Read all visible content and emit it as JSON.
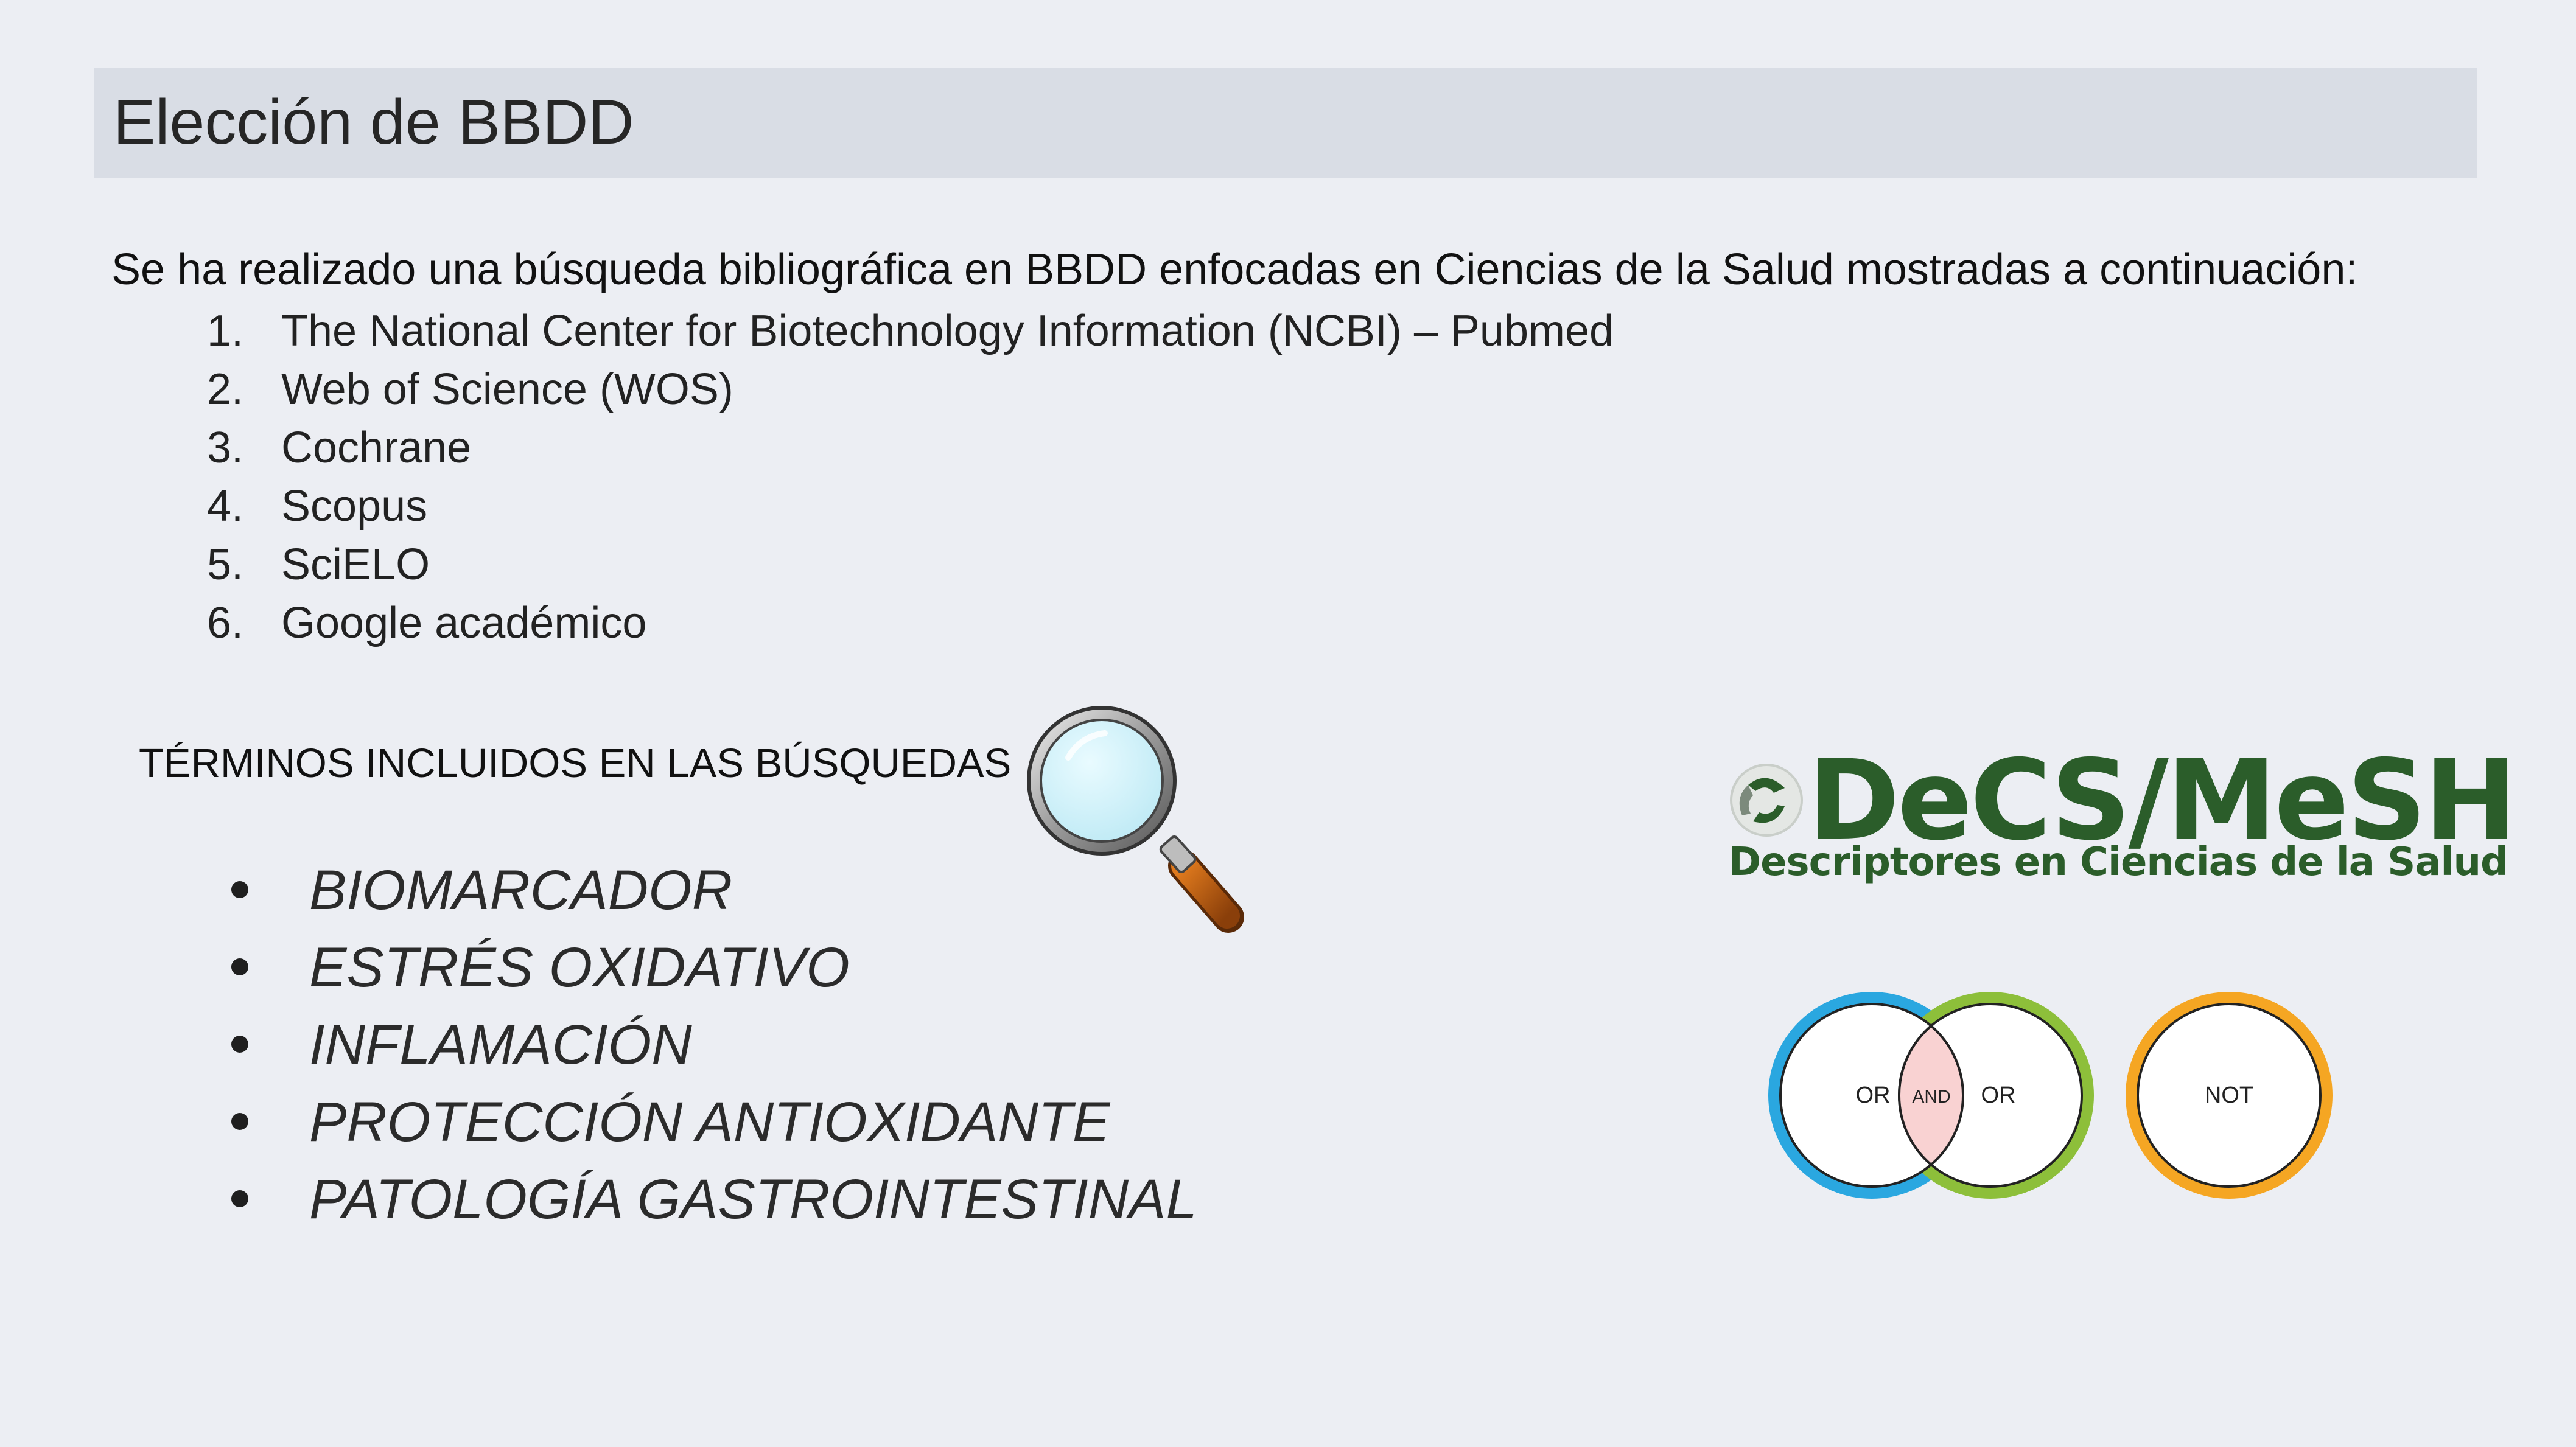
{
  "slide": {
    "title": "Elección de BBDD",
    "intro": "Se ha realizado una búsqueda bibliográfica en BBDD enfocadas en Ciencias de la Salud mostradas a continuación:"
  },
  "databases": [
    {
      "num": "1.",
      "label": "The National Center for Biotechnology Information (NCBI) – Pubmed"
    },
    {
      "num": "2.",
      "label": "Web of Science (WOS)"
    },
    {
      "num": "3.",
      "label": "Cochrane"
    },
    {
      "num": "4.",
      "label": "Scopus"
    },
    {
      "num": "5.",
      "label": "SciELO"
    },
    {
      "num": "6.",
      "label": "Google académico"
    }
  ],
  "terms": {
    "heading": "TÉRMINOS INCLUIDOS EN LAS BÚSQUEDAS",
    "items": [
      "BIOMARCADOR",
      "ESTRÉS OXIDATIVO",
      "INFLAMACIÓN",
      "PROTECCIÓN ANTIOXIDANTE",
      "PATOLOGÍA GASTROINTESTINAL"
    ]
  },
  "logo": {
    "title": "DeCS/MeSH",
    "subtitle": "Descriptores en Ciencias de la Salud",
    "color": "#2b5d2a"
  },
  "operators": {
    "left": "OR",
    "middle": "AND",
    "right": "OR",
    "not": "NOT",
    "colors": {
      "blue": "#2aa7e0",
      "green": "#8dbf3a",
      "orange": "#f5a623",
      "overlap": "#f9d2d2"
    }
  },
  "icons": {
    "magnifier": "magnifying-glass-icon",
    "decs_mark": "decs-swirl-icon"
  }
}
